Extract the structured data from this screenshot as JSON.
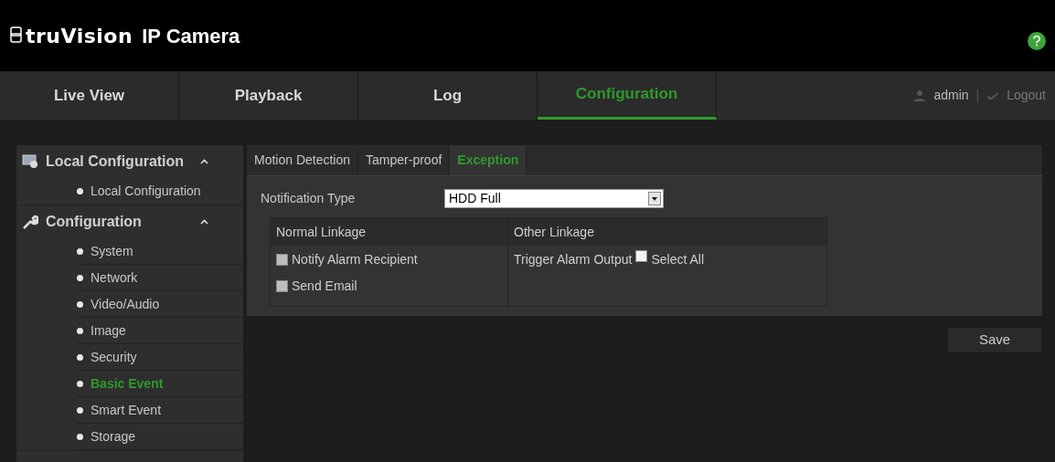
{
  "header": {
    "brand": "truVision",
    "title": "IP Camera"
  },
  "nav": [
    {
      "label": "Live View",
      "selected": false
    },
    {
      "label": "Playback",
      "selected": false
    },
    {
      "label": "Log",
      "selected": false
    },
    {
      "label": "Configuration",
      "selected": true
    }
  ],
  "user": {
    "name": "admin",
    "separator": "|",
    "logout": "Logout"
  },
  "sidebar": [
    {
      "label": "Local Configuration",
      "expanded": true,
      "children": [
        {
          "label": "Local Configuration",
          "selected": false
        }
      ]
    },
    {
      "label": "Configuration",
      "expanded": true,
      "children": [
        {
          "label": "System",
          "selected": false
        },
        {
          "label": "Network",
          "selected": false
        },
        {
          "label": "Video/Audio",
          "selected": false
        },
        {
          "label": "Image",
          "selected": false
        },
        {
          "label": "Security",
          "selected": false
        },
        {
          "label": "Basic Event",
          "selected": true
        },
        {
          "label": "Smart Event",
          "selected": false
        },
        {
          "label": "Storage",
          "selected": false
        }
      ]
    }
  ],
  "tabs": [
    {
      "label": "Motion Detection",
      "selected": false
    },
    {
      "label": "Tamper-proof",
      "selected": false
    },
    {
      "label": "Exception",
      "selected": true
    }
  ],
  "notification_type": {
    "label": "Notification Type",
    "value": "HDD Full"
  },
  "linkage": {
    "normal_header": "Normal Linkage",
    "other_header": "Other Linkage",
    "normal": [
      {
        "label": "Notify Alarm Recipient",
        "checked": false
      },
      {
        "label": "Send Email",
        "checked": false
      }
    ],
    "other_label": "Trigger Alarm Output",
    "select_all": {
      "label": "Select All",
      "checked": false
    }
  },
  "save": "Save"
}
